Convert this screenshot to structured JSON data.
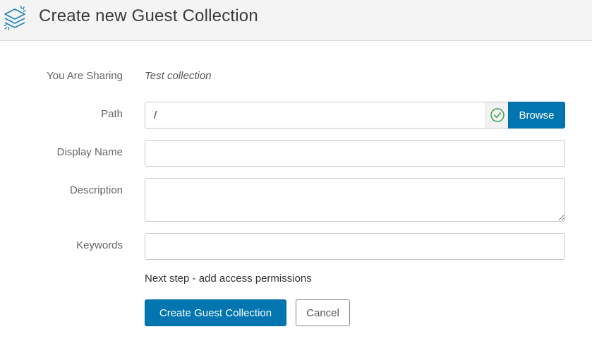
{
  "header": {
    "title": "Create new Guest Collection",
    "icon": "layers-icon"
  },
  "form": {
    "sharing": {
      "label": "You Are Sharing",
      "value": "Test collection"
    },
    "path": {
      "label": "Path",
      "value": "/",
      "status_icon": "check-circle-icon",
      "browse_label": "Browse"
    },
    "display_name": {
      "label": "Display Name",
      "value": ""
    },
    "description": {
      "label": "Description",
      "value": ""
    },
    "keywords": {
      "label": "Keywords",
      "value": ""
    },
    "next_step": "Next step - add access permissions",
    "submit_label": "Create Guest Collection",
    "cancel_label": "Cancel"
  },
  "colors": {
    "primary": "#0075b0",
    "success": "#2e9e44"
  }
}
